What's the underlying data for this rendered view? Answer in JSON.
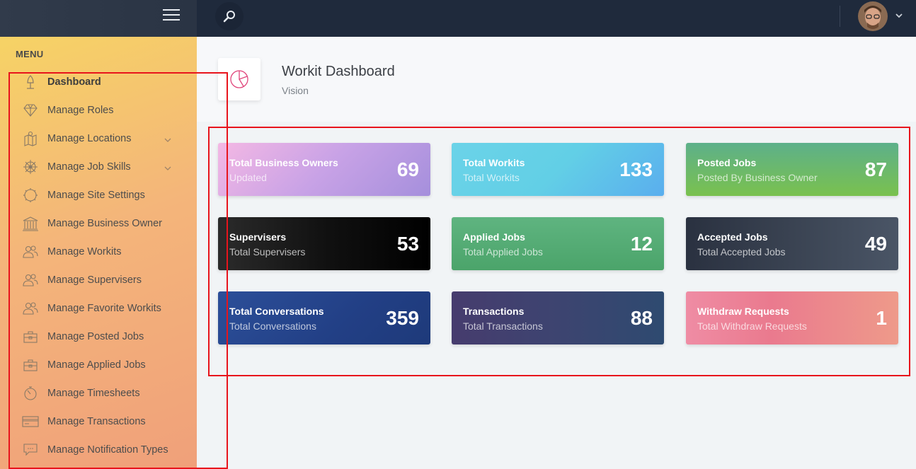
{
  "sidebar": {
    "menu_header": "MENU",
    "items": [
      {
        "label": "Dashboard",
        "icon": "rocket-icon",
        "active": true
      },
      {
        "label": "Manage Roles",
        "icon": "diamond-icon"
      },
      {
        "label": "Manage Locations",
        "icon": "map-icon",
        "has_children": true
      },
      {
        "label": "Manage Job Skills",
        "icon": "ship-wheel-icon",
        "has_children": true
      },
      {
        "label": "Manage Site Settings",
        "icon": "gear-icon"
      },
      {
        "label": "Manage Business Owner",
        "icon": "bank-icon"
      },
      {
        "label": "Manage Workits",
        "icon": "users-icon"
      },
      {
        "label": "Manage Supervisers",
        "icon": "users-icon"
      },
      {
        "label": "Manage Favorite Workits",
        "icon": "users-icon"
      },
      {
        "label": "Manage Posted Jobs",
        "icon": "briefcase-icon"
      },
      {
        "label": "Manage Applied Jobs",
        "icon": "briefcase-icon"
      },
      {
        "label": "Manage Timesheets",
        "icon": "stopwatch-icon"
      },
      {
        "label": "Manage Transactions",
        "icon": "credit-card-icon"
      },
      {
        "label": "Manage Notification Types",
        "icon": "chat-icon"
      }
    ]
  },
  "header": {
    "title": "Workit Dashboard",
    "subtitle": "Vision",
    "icon": "pie-chart-icon"
  },
  "cards": [
    {
      "title": "Total Business Owners",
      "subtitle": "Updated",
      "value": "69"
    },
    {
      "title": "Total Workits",
      "subtitle": "Total Workits",
      "value": "133"
    },
    {
      "title": "Posted Jobs",
      "subtitle": "Posted By Business Owner",
      "value": "87"
    },
    {
      "title": "Supervisers",
      "subtitle": "Total Supervisers",
      "value": "53"
    },
    {
      "title": "Applied Jobs",
      "subtitle": "Total Applied Jobs",
      "value": "12"
    },
    {
      "title": "Accepted Jobs",
      "subtitle": "Total Accepted Jobs",
      "value": "49"
    },
    {
      "title": "Total Conversations",
      "subtitle": "Total Conversations",
      "value": "359"
    },
    {
      "title": "Transactions",
      "subtitle": "Total Transactions",
      "value": "88"
    },
    {
      "title": "Withdraw Requests",
      "subtitle": "Total Withdraw Requests",
      "value": "1"
    }
  ],
  "colors": {
    "topbar": "#1f2a3c",
    "highlight": "#e8141c",
    "accent_pink": "#e0457b"
  }
}
